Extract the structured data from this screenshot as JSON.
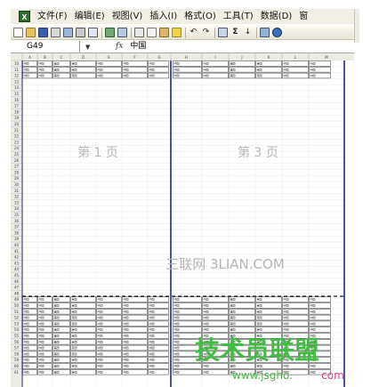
{
  "menu": {
    "app_icon": "excel-icon",
    "items": [
      {
        "id": "file",
        "label": "文件(F)"
      },
      {
        "id": "edit",
        "label": "编辑(E)"
      },
      {
        "id": "view",
        "label": "视图(V)"
      },
      {
        "id": "insert",
        "label": "插入(I)"
      },
      {
        "id": "format",
        "label": "格式(O)"
      },
      {
        "id": "tools",
        "label": "工具(T)"
      },
      {
        "id": "data",
        "label": "数据(D)"
      },
      {
        "id": "window",
        "label": "窗"
      }
    ]
  },
  "formula_bar": {
    "name_box": "G49",
    "fx": "fx",
    "content": "中国"
  },
  "sheet": {
    "column_headers": [
      "A",
      "B",
      "C",
      "D",
      "E",
      "F",
      "G",
      "H",
      "I",
      "J",
      "K",
      "L",
      "M"
    ],
    "row_numbers": [
      "10",
      "11",
      "12",
      "13",
      "14",
      "15",
      "16",
      "17",
      "18",
      "19",
      "20",
      "21",
      "22",
      "23",
      "24",
      "25",
      "26",
      "27",
      "28",
      "29",
      "30",
      "31",
      "32",
      "33",
      "34",
      "35",
      "36",
      "37",
      "38",
      "39",
      "40",
      "41",
      "42",
      "43",
      "44",
      "45",
      "46",
      "47",
      "48",
      "49",
      "50",
      "51",
      "52",
      "53",
      "54",
      "55",
      "56",
      "57",
      "58",
      "59",
      "60",
      "61"
    ],
    "page_labels": [
      "第 1 页",
      "第 3 页"
    ],
    "cell_words": [
      "中国",
      "中国",
      "美国",
      "英国",
      "中国",
      "中国"
    ],
    "watermark_text": "三联网 3LIAN.COM",
    "watermark_brand": "技术员联盟",
    "watermark_url_main": "www.jsgho.",
    "watermark_url_end": "com",
    "page_break_color": "#1f2a8a",
    "dashed_break_color": "#222222"
  }
}
